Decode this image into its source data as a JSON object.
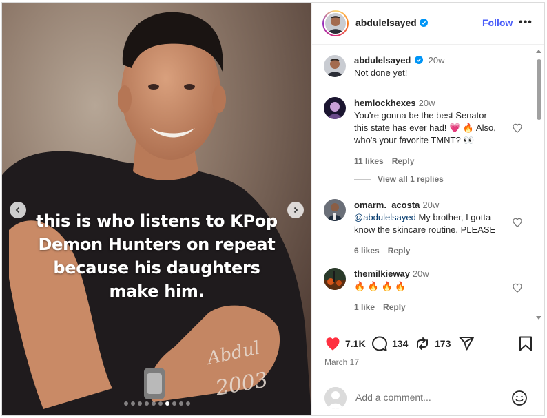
{
  "post": {
    "caption_lines": [
      "this is who listens to KPop",
      "Demon Hunters on repeat",
      "because his daughters",
      "make him."
    ],
    "photo_signature": "Abdul 2003",
    "slide_count": 10,
    "active_slide_index": 6
  },
  "header": {
    "username": "abdulelsayed",
    "verified": true,
    "follow_label": "Follow",
    "more_label": "•••"
  },
  "comments": [
    {
      "username": "abdulelsayed",
      "time": "20w",
      "text": "Not done yet!",
      "verified": true,
      "is_author": true
    },
    {
      "username": "hemlockhexes",
      "time": "20w",
      "text_line1": "You're gonna be the best Senator",
      "text_line2": "this state has ever had! 💗 🔥 Also,",
      "text_line3": "who's your favorite TMNT? 👀",
      "likes": "11 likes",
      "reply": "Reply",
      "view_replies": "View all 1 replies"
    },
    {
      "username": "omarm._acosta",
      "time": "20w",
      "mention": "@abdulelsayed",
      "text_line1": " My brother, I gotta",
      "text_line2": "know the skincare routine. PLEASE",
      "likes": "6 likes",
      "reply": "Reply"
    },
    {
      "username": "themilkieway",
      "time": "20w",
      "text": "🔥 🔥 🔥 🔥",
      "likes": "1 like",
      "reply": "Reply"
    }
  ],
  "actions": {
    "likes_count": "7.1K",
    "comments_count": "134",
    "reposts_count": "173",
    "date": "March 17"
  },
  "add_comment": {
    "placeholder": "Add a comment..."
  },
  "colors": {
    "like_red": "#ff3040",
    "follow_blue": "#4a5df9",
    "verified_blue": "#0095f6"
  }
}
